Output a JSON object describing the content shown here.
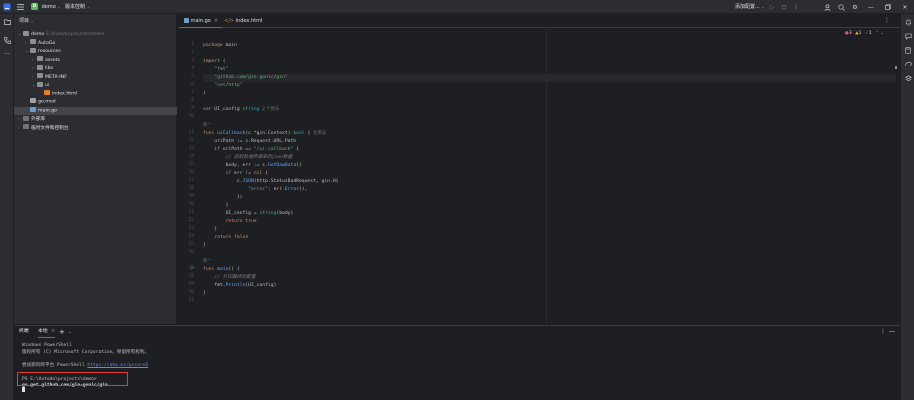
{
  "titlebar": {
    "project_badge": "D",
    "project_name": "demo",
    "vcs_label": "版本控制",
    "run_config": "添加配置..."
  },
  "project_panel": {
    "title": "项目",
    "tree": [
      {
        "label": "demo",
        "hint": "E:\\Autodo\\projects\\demo",
        "depth": 0,
        "expanded": true,
        "icon": "folder"
      },
      {
        "label": "AutoGo",
        "depth": 1,
        "expanded": false,
        "icon": "folder"
      },
      {
        "label": "resources",
        "depth": 1,
        "expanded": true,
        "icon": "folder"
      },
      {
        "label": "assets",
        "depth": 2,
        "expanded": false,
        "icon": "folder"
      },
      {
        "label": "libs",
        "depth": 2,
        "expanded": false,
        "icon": "folder"
      },
      {
        "label": "META-INF",
        "depth": 2,
        "expanded": false,
        "icon": "folder"
      },
      {
        "label": "ui",
        "depth": 2,
        "expanded": true,
        "icon": "folder"
      },
      {
        "label": "index.html",
        "depth": 3,
        "icon": "file-html"
      },
      {
        "label": "go.mod",
        "depth": 1,
        "icon": "file-mod"
      },
      {
        "label": "main.go",
        "depth": 1,
        "icon": "file-go",
        "selected": true
      },
      {
        "label": "外部库",
        "depth": 0,
        "expanded": false,
        "icon": "lib"
      },
      {
        "label": "临时文件和控制台",
        "depth": 0,
        "expanded": false,
        "icon": "lib"
      }
    ]
  },
  "editor": {
    "tabs": [
      {
        "label": "main.go",
        "active": true
      },
      {
        "label": "index.html",
        "active": false
      }
    ],
    "inspections": {
      "errors": "3",
      "warnings": "1",
      "weak": "1"
    },
    "lines": [
      {
        "n": "1",
        "tokens": [
          [
            "kw",
            "package "
          ],
          [
            "pkg",
            "main"
          ]
        ]
      },
      {
        "n": "2",
        "tokens": []
      },
      {
        "n": "3",
        "tokens": [
          [
            "kw",
            "import "
          ],
          [
            "pkg",
            "("
          ]
        ]
      },
      {
        "n": "4",
        "tokens": [
          [
            "pkg",
            "    "
          ],
          [
            "str",
            "\"fmt\""
          ]
        ]
      },
      {
        "n": "5",
        "tokens": [
          [
            "pkg",
            "    "
          ],
          [
            "str",
            "\"github.com/gin-gonic/gin\""
          ]
        ],
        "highlight": true
      },
      {
        "n": "6",
        "tokens": [
          [
            "pkg",
            "    "
          ],
          [
            "str",
            "\"net/http\""
          ]
        ]
      },
      {
        "n": "7",
        "tokens": [
          [
            "pkg",
            ")"
          ]
        ]
      },
      {
        "n": "8",
        "tokens": []
      },
      {
        "n": "9",
        "tokens": [
          [
            "kw",
            "var "
          ],
          [
            "pkg",
            "UI_config "
          ],
          [
            "typ",
            "string"
          ],
          [
            "inl",
            "  2 个用法"
          ]
        ]
      },
      {
        "n": "10",
        "tokens": []
      },
      {
        "n": "",
        "tokens": [
          [
            "inl",
            "新 *"
          ]
        ]
      },
      {
        "n": "11",
        "tokens": [
          [
            "kw",
            "func "
          ],
          [
            "fn",
            "uiCallback"
          ],
          [
            "pkg",
            "(c *gin.Context) "
          ],
          [
            "typ",
            "bool"
          ],
          [
            "pkg",
            " {"
          ],
          [
            "inl",
            "  无用法"
          ]
        ]
      },
      {
        "n": "12",
        "tokens": [
          [
            "pkg",
            "    uriPath := c.Request.URL.Path"
          ]
        ]
      },
      {
        "n": "13",
        "tokens": [
          [
            "pkg",
            "    "
          ],
          [
            "kw",
            "if "
          ],
          [
            "pkg",
            "uriPath == "
          ],
          [
            "str",
            "\"/ui-callback\""
          ],
          [
            "pkg",
            " {"
          ]
        ]
      },
      {
        "n": "14",
        "tokens": [
          [
            "pkg",
            "        "
          ],
          [
            "cmt",
            "// 获取前端传递来的json数据"
          ]
        ]
      },
      {
        "n": "15",
        "tokens": [
          [
            "pkg",
            "        body, err := c."
          ],
          [
            "fn",
            "GetRawData"
          ],
          [
            "pkg",
            "()"
          ]
        ]
      },
      {
        "n": "16",
        "tokens": [
          [
            "pkg",
            "        "
          ],
          [
            "kw",
            "if "
          ],
          [
            "pkg",
            "err != "
          ],
          [
            "kw",
            "nil"
          ],
          [
            "pkg",
            " {"
          ]
        ]
      },
      {
        "n": "17",
        "tokens": [
          [
            "pkg",
            "            c."
          ],
          [
            "fn",
            "JSON"
          ],
          [
            "pkg",
            "(http.StatusBadRequest, gin.H{"
          ]
        ]
      },
      {
        "n": "18",
        "tokens": [
          [
            "pkg",
            "                "
          ],
          [
            "str",
            "\"error\""
          ],
          [
            "pkg",
            ": err."
          ],
          [
            "fn",
            "Error"
          ],
          [
            "pkg",
            "(),"
          ]
        ]
      },
      {
        "n": "19",
        "tokens": [
          [
            "pkg",
            "            })"
          ]
        ]
      },
      {
        "n": "20",
        "tokens": [
          [
            "pkg",
            "        }"
          ]
        ]
      },
      {
        "n": "21",
        "tokens": [
          [
            "pkg",
            "        UI_config = "
          ],
          [
            "typ",
            "string"
          ],
          [
            "pkg",
            "(body)"
          ]
        ]
      },
      {
        "n": "22",
        "tokens": [
          [
            "pkg",
            "        "
          ],
          [
            "kw",
            "return "
          ],
          [
            "kw",
            "true"
          ]
        ]
      },
      {
        "n": "23",
        "tokens": [
          [
            "pkg",
            "    }"
          ]
        ]
      },
      {
        "n": "24",
        "tokens": [
          [
            "pkg",
            "    "
          ],
          [
            "kw",
            "return "
          ],
          [
            "kw",
            "false"
          ]
        ]
      },
      {
        "n": "25",
        "tokens": [
          [
            "pkg",
            "}"
          ]
        ]
      },
      {
        "n": "26",
        "tokens": []
      },
      {
        "n": "",
        "tokens": [
          [
            "inl",
            "新 *"
          ]
        ]
      },
      {
        "n": "27",
        "tokens": [
          [
            "kw",
            "func "
          ],
          [
            "fn",
            "main"
          ],
          [
            "pkg",
            "() {"
          ]
        ],
        "run": true
      },
      {
        "n": "28",
        "tokens": [
          [
            "pkg",
            "    "
          ],
          [
            "cmt",
            "// 打印最终的配置"
          ]
        ]
      },
      {
        "n": "29",
        "tokens": [
          [
            "pkg",
            "    fmt."
          ],
          [
            "fn",
            "Println"
          ],
          [
            "pkg",
            "(UI_config)"
          ]
        ]
      },
      {
        "n": "30",
        "tokens": [
          [
            "pkg",
            "}"
          ]
        ]
      },
      {
        "n": "31",
        "tokens": []
      }
    ]
  },
  "terminal": {
    "title": "终端",
    "tab_label": "本地",
    "lines": [
      {
        "text": "Windows PowerShell",
        "style": ""
      },
      {
        "text": "版权所有 (C) Microsoft Corporation。保留所有权利。",
        "style": ""
      },
      {
        "text": "",
        "style": ""
      },
      {
        "text": "尝试新的跨平台 PowerShell ",
        "link": "https://aka.ms/pscore6",
        "style": ""
      },
      {
        "text": "",
        "style": ""
      },
      {
        "text": "PS E:\\Autodo\\projects\\demo>",
        "style": ""
      },
      {
        "text": "go get github.com/gin-gonic/gin",
        "style": "bold"
      }
    ]
  }
}
